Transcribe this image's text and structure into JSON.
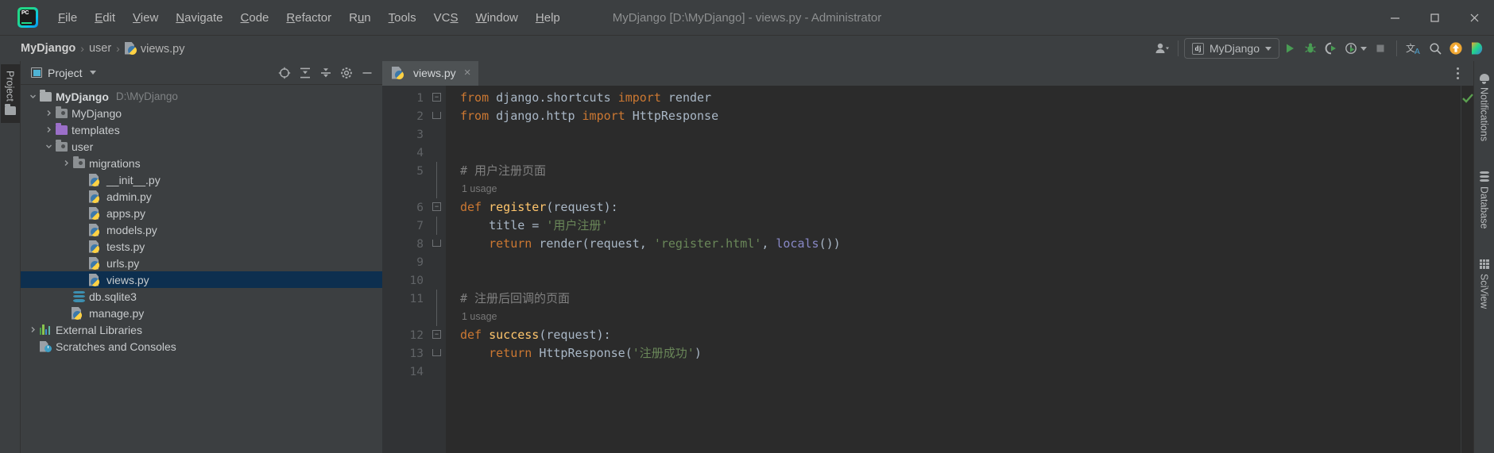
{
  "window": {
    "title": "MyDjango [D:\\MyDjango] - views.py - Administrator",
    "minimize_label": "Minimize",
    "maximize_label": "Maximize",
    "close_label": "Close",
    "logo_text": "PC"
  },
  "menu": {
    "items": [
      {
        "label": "File",
        "mnemonic": "F"
      },
      {
        "label": "Edit",
        "mnemonic": "E"
      },
      {
        "label": "View",
        "mnemonic": "V"
      },
      {
        "label": "Navigate",
        "mnemonic": "N"
      },
      {
        "label": "Code",
        "mnemonic": "C"
      },
      {
        "label": "Refactor",
        "mnemonic": "R"
      },
      {
        "label": "Run",
        "mnemonic": "u"
      },
      {
        "label": "Tools",
        "mnemonic": "T"
      },
      {
        "label": "VCS",
        "mnemonic": "S"
      },
      {
        "label": "Window",
        "mnemonic": "W"
      },
      {
        "label": "Help",
        "mnemonic": "H"
      }
    ]
  },
  "breadcrumb": {
    "items": [
      "MyDjango",
      "user",
      "views.py"
    ],
    "separator": "›"
  },
  "toolbar": {
    "run_config_label": "MyDjango",
    "run_config_icon": "django-icon",
    "user_icon": "user-account-icon",
    "buttons": [
      {
        "name": "run-button",
        "label": "Run"
      },
      {
        "name": "debug-button",
        "label": "Debug"
      },
      {
        "name": "run-coverage-button",
        "label": "Run with Coverage"
      },
      {
        "name": "profile-button",
        "label": "Profile"
      },
      {
        "name": "stop-button",
        "label": "Stop"
      },
      {
        "name": "translate-button",
        "label": "Translate"
      },
      {
        "name": "search-button",
        "label": "Search Everywhere"
      },
      {
        "name": "update-button",
        "label": "Update"
      },
      {
        "name": "ide-feature-button",
        "label": "IDE Features"
      }
    ],
    "translate_glyph": "文A"
  },
  "left_stripe": {
    "tabs": [
      {
        "label": "Project",
        "icon": "folder-icon",
        "active": true
      }
    ]
  },
  "right_stripe": {
    "tabs": [
      {
        "label": "Notifications",
        "icon": "bell-icon"
      },
      {
        "label": "Database",
        "icon": "database-icon"
      },
      {
        "label": "SciView",
        "icon": "grid-icon"
      }
    ]
  },
  "project_panel": {
    "title": "Project",
    "header_buttons": [
      {
        "name": "select-opened-file-button",
        "label": "Select Opened File"
      },
      {
        "name": "expand-all-button",
        "label": "Expand All"
      },
      {
        "name": "collapse-all-button",
        "label": "Collapse All"
      },
      {
        "name": "settings-button",
        "label": "Settings"
      },
      {
        "name": "hide-button",
        "label": "Hide"
      }
    ],
    "tree": [
      {
        "label": "MyDjango",
        "sub": "D:\\MyDjango",
        "indent": 0,
        "arrow": "down",
        "icon": "folder-root-icon",
        "bold": true,
        "selected": false
      },
      {
        "label": "MyDjango",
        "sub": "",
        "indent": 1,
        "arrow": "right",
        "icon": "folder-module-icon",
        "bold": false,
        "selected": false
      },
      {
        "label": "templates",
        "sub": "",
        "indent": 1,
        "arrow": "right",
        "icon": "folder-template-icon",
        "bold": false,
        "selected": false
      },
      {
        "label": "user",
        "sub": "",
        "indent": 1,
        "arrow": "down",
        "icon": "folder-module-icon",
        "bold": false,
        "selected": false
      },
      {
        "label": "migrations",
        "sub": "",
        "indent": 2,
        "arrow": "right",
        "icon": "folder-module-icon",
        "bold": false,
        "selected": false
      },
      {
        "label": "__init__.py",
        "sub": "",
        "indent": 3,
        "arrow": "none",
        "icon": "python-file-icon",
        "bold": false,
        "selected": false
      },
      {
        "label": "admin.py",
        "sub": "",
        "indent": 3,
        "arrow": "none",
        "icon": "python-file-icon",
        "bold": false,
        "selected": false
      },
      {
        "label": "apps.py",
        "sub": "",
        "indent": 3,
        "arrow": "none",
        "icon": "python-file-icon",
        "bold": false,
        "selected": false
      },
      {
        "label": "models.py",
        "sub": "",
        "indent": 3,
        "arrow": "none",
        "icon": "python-file-icon",
        "bold": false,
        "selected": false
      },
      {
        "label": "tests.py",
        "sub": "",
        "indent": 3,
        "arrow": "none",
        "icon": "python-file-icon",
        "bold": false,
        "selected": false
      },
      {
        "label": "urls.py",
        "sub": "",
        "indent": 3,
        "arrow": "none",
        "icon": "python-file-icon",
        "bold": false,
        "selected": false
      },
      {
        "label": "views.py",
        "sub": "",
        "indent": 3,
        "arrow": "none",
        "icon": "python-file-icon",
        "bold": false,
        "selected": true
      },
      {
        "label": "db.sqlite3",
        "sub": "",
        "indent": 2,
        "arrow": "none",
        "icon": "database-file-icon",
        "bold": false,
        "selected": false
      },
      {
        "label": "manage.py",
        "sub": "",
        "indent": 2,
        "arrow": "none",
        "icon": "python-file-icon",
        "bold": false,
        "selected": false
      },
      {
        "label": "External Libraries",
        "sub": "",
        "indent": 0,
        "arrow": "right",
        "icon": "libraries-icon",
        "bold": false,
        "selected": false
      },
      {
        "label": "Scratches and Consoles",
        "sub": "",
        "indent": 0,
        "arrow": "none",
        "icon": "scratches-icon",
        "bold": false,
        "selected": false
      }
    ]
  },
  "editor": {
    "tab": {
      "label": "views.py",
      "icon": "python-file-icon",
      "close_glyph": "×"
    },
    "options_icon": "more-options-icon",
    "inspection_status": "ok",
    "lines": [
      {
        "num": "1",
        "fold": "start",
        "gutter": "",
        "tokens": [
          {
            "t": "from ",
            "c": "k"
          },
          {
            "t": "django.shortcuts ",
            "c": "id"
          },
          {
            "t": "import ",
            "c": "k"
          },
          {
            "t": "render",
            "c": "id"
          }
        ]
      },
      {
        "num": "2",
        "fold": "end",
        "gutter": "",
        "tokens": [
          {
            "t": "from ",
            "c": "k"
          },
          {
            "t": "django.http ",
            "c": "id"
          },
          {
            "t": "import ",
            "c": "k"
          },
          {
            "t": "HttpResponse",
            "c": "id"
          }
        ]
      },
      {
        "num": "3",
        "fold": "",
        "gutter": "",
        "tokens": []
      },
      {
        "num": "4",
        "fold": "",
        "gutter": "",
        "tokens": []
      },
      {
        "num": "5",
        "fold": "",
        "gutter": "",
        "tokens": [
          {
            "t": "# 用户注册页面",
            "c": "cm"
          }
        ]
      },
      {
        "num": "",
        "fold": "",
        "gutter": "",
        "hint": "1 usage",
        "tokens": []
      },
      {
        "num": "6",
        "fold": "start",
        "gutter": "",
        "tokens": [
          {
            "t": "def ",
            "c": "k"
          },
          {
            "t": "register",
            "c": "fn"
          },
          {
            "t": "(request):",
            "c": "pn"
          }
        ]
      },
      {
        "num": "7",
        "fold": "",
        "gutter": "",
        "tokens": [
          {
            "t": "    title = ",
            "c": "id"
          },
          {
            "t": "'用户注册'",
            "c": "st"
          }
        ]
      },
      {
        "num": "8",
        "fold": "end",
        "gutter": "html",
        "tokens": [
          {
            "t": "    ",
            "c": "id"
          },
          {
            "t": "return ",
            "c": "k"
          },
          {
            "t": "render(request, ",
            "c": "id"
          },
          {
            "t": "'register.html'",
            "c": "st"
          },
          {
            "t": ", ",
            "c": "pn"
          },
          {
            "t": "locals",
            "c": "bi"
          },
          {
            "t": "())",
            "c": "pn"
          }
        ]
      },
      {
        "num": "9",
        "fold": "",
        "gutter": "",
        "tokens": []
      },
      {
        "num": "10",
        "fold": "",
        "gutter": "",
        "tokens": []
      },
      {
        "num": "11",
        "fold": "",
        "gutter": "",
        "tokens": [
          {
            "t": "# 注册后回调的页面",
            "c": "cm"
          }
        ]
      },
      {
        "num": "",
        "fold": "",
        "gutter": "",
        "hint": "1 usage",
        "tokens": []
      },
      {
        "num": "12",
        "fold": "start",
        "gutter": "",
        "tokens": [
          {
            "t": "def ",
            "c": "k"
          },
          {
            "t": "success",
            "c": "fn"
          },
          {
            "t": "(request):",
            "c": "pn"
          }
        ]
      },
      {
        "num": "13",
        "fold": "end",
        "gutter": "",
        "tokens": [
          {
            "t": "    ",
            "c": "id"
          },
          {
            "t": "return ",
            "c": "k"
          },
          {
            "t": "HttpResponse(",
            "c": "id"
          },
          {
            "t": "'注册成功'",
            "c": "st"
          },
          {
            "t": ")",
            "c": "pn"
          }
        ]
      },
      {
        "num": "14",
        "fold": "",
        "gutter": "",
        "tokens": []
      }
    ]
  },
  "colors": {
    "chrome": "#3c3f41",
    "editor_bg": "#2b2b2b",
    "gutter_bg": "#313335",
    "selection": "#0d2f4f",
    "keyword": "#cc7832",
    "function": "#ffc66d",
    "string": "#6a8759",
    "comment": "#808080",
    "identifier": "#a9b7c6",
    "builtin": "#8888c6",
    "accent_green": "#499c54",
    "accent_orange": "#f0a732"
  }
}
